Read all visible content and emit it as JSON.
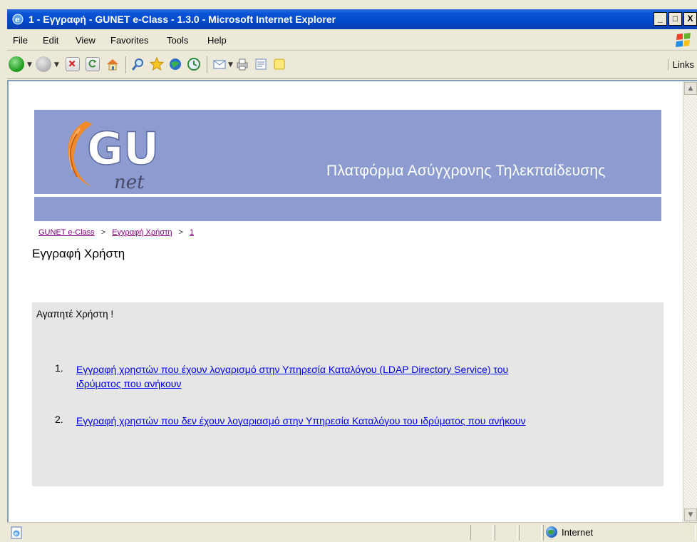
{
  "window": {
    "title": "1 - Εγγραφή - GUNET e-Class - 1.3.0 - Microsoft Internet Explorer",
    "controls": {
      "minimize": "_",
      "maximize": "□",
      "close": "X"
    }
  },
  "menu": [
    "File",
    "Edit",
    "View",
    "Favorites",
    "Tools",
    "Help"
  ],
  "toolbar": {
    "links_label": "Links",
    "icons": [
      "back-icon",
      "forward-icon",
      "stop-icon",
      "refresh-icon",
      "home-icon",
      "search-icon",
      "favorites-icon",
      "media-icon",
      "history-icon",
      "mail-icon",
      "print-icon",
      "edit-icon",
      "messenger-icon"
    ]
  },
  "banner": {
    "logo_text": "GU",
    "logo_sub": "net",
    "tagline": "Πλατφόρμα Ασύγχρονης Τηλεκπαίδευσης"
  },
  "breadcrumb": {
    "home": "GUNET e-Class",
    "section": "Εγγραφή Χρήστη",
    "current": "1",
    "separator": ">"
  },
  "page": {
    "title": "Εγγραφή Χρήστη",
    "greeting": "Αγαπητέ Χρήστη !",
    "options": [
      {
        "num": "1.",
        "line1": "Εγγραφή χρηστών που έχουν λογαρισμό στην Υπηρεσία Καταλόγου (LDAP Directory Service) του",
        "line2": "ιδρύματος που ανήκουν"
      },
      {
        "num": "2.",
        "line1": "Εγγραφή χρηστών που δεν έχουν λογαριασμό στην Υπηρεσία Καταλόγου του ιδρύματος που ανήκουν"
      }
    ]
  },
  "status": {
    "zone": "Internet"
  },
  "colors": {
    "banner": "#8c9bd0",
    "panel": "#e6e6e6",
    "link": "#0000ee",
    "visited": "#800080"
  }
}
